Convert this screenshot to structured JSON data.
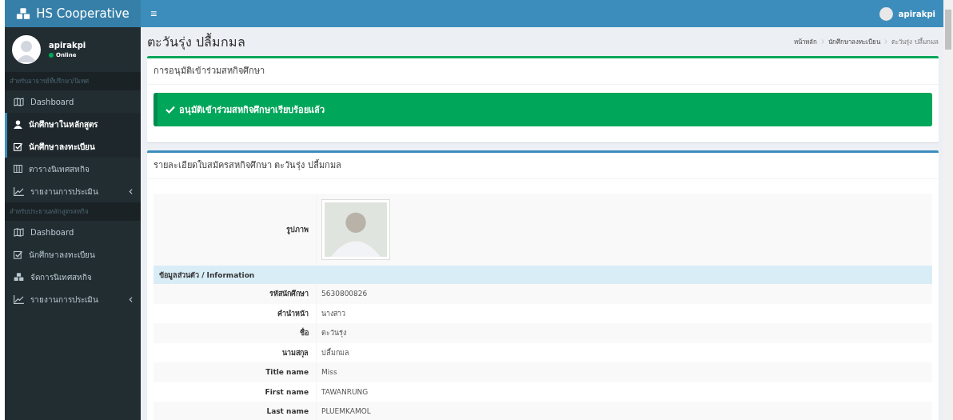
{
  "header": {
    "brand": "HS Cooperative",
    "menu_icon": "≡",
    "user": "apirakpi"
  },
  "sidebar": {
    "user": {
      "name": "apirakpi",
      "status": "Online"
    },
    "sections": [
      {
        "header": "สำหรับอาจารย์ที่ปรึกษา/นิเทศ",
        "items": [
          {
            "label": "Dashboard",
            "kind": "map",
            "selected": false,
            "expandable": false
          },
          {
            "label": "นักศึกษาในหลักสูตร",
            "kind": "user",
            "selected": true,
            "expandable": false
          },
          {
            "label": "นักศึกษาลงทะเบียน",
            "kind": "check",
            "selected": true,
            "expandable": false
          },
          {
            "label": "ตารางนิเทศสหกิจ",
            "kind": "table",
            "selected": false,
            "expandable": false
          },
          {
            "label": "รายงานการประเมิน",
            "kind": "chart",
            "selected": false,
            "expandable": true
          }
        ]
      },
      {
        "header": "สำหรับประธานหลักสูตรสหกิจ",
        "items": [
          {
            "label": "Dashboard",
            "kind": "map",
            "selected": false,
            "expandable": false
          },
          {
            "label": "นักศึกษาลงทะเบียน",
            "kind": "check",
            "selected": false,
            "expandable": false
          },
          {
            "label": "จัดการนิเทศสหกิจ",
            "kind": "cubes",
            "selected": false,
            "expandable": false
          },
          {
            "label": "รายงานการประเมิน",
            "kind": "chart",
            "selected": false,
            "expandable": true
          }
        ]
      }
    ]
  },
  "page_title": "ตะวันรุ่ง ปลื้มกมล",
  "breadcrumb": [
    "หน้าหลัก",
    "นักศึกษาลงทะเบียน",
    "ตะวันรุ่ง ปลื้มกมล"
  ],
  "approval_box": {
    "title": "การอนุมัติเข้าร่วมสหกิจศึกษา",
    "alert": "อนุมัติเข้าร่วมสหกิจศึกษาเรียบร้อยแล้ว"
  },
  "detail_box": {
    "title": "รายละเอียดใบสมัครสหกิจศึกษา ตะวันรุ่ง ปลื้มกมล",
    "rows": [
      {
        "kind": "photo",
        "label": "รูปภาพ"
      },
      {
        "kind": "section",
        "label": "ข้อมูลส่วนตัว / Information"
      },
      {
        "kind": "field",
        "label": "รหัสนักศึกษา",
        "value": "5630800826"
      },
      {
        "kind": "field",
        "label": "คำนำหน้า",
        "value": "นางสาว"
      },
      {
        "kind": "field",
        "label": "ชื่อ",
        "value": "ตะวันรุ่ง"
      },
      {
        "kind": "field",
        "label": "นามสกุล",
        "value": "ปลื้มกมล"
      },
      {
        "kind": "field",
        "label": "Title name",
        "value": "Miss"
      },
      {
        "kind": "field",
        "label": "First name",
        "value": "TAWANRUNG"
      },
      {
        "kind": "field",
        "label": "Last name",
        "value": "PLUEMKAMOL"
      }
    ]
  }
}
